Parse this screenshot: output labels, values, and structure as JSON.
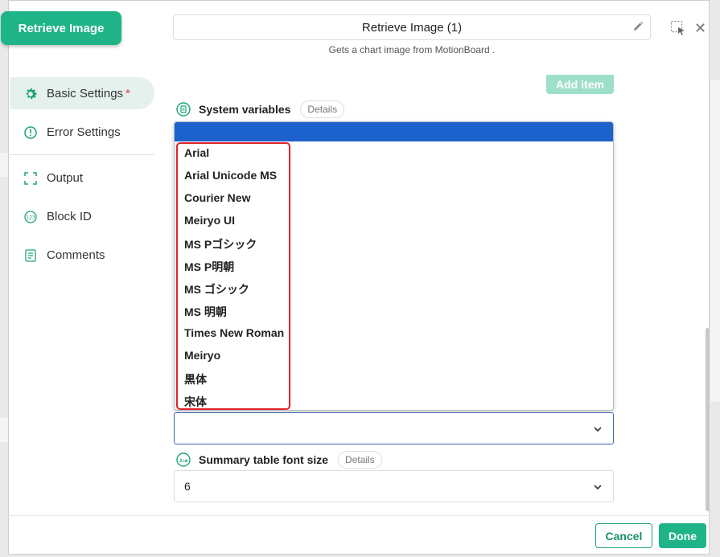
{
  "block_tag": "Retrieve Image",
  "header": {
    "title": "Retrieve Image (1)",
    "subtitle": "Gets a chart image from MotionBoard ."
  },
  "sidebar": {
    "items": [
      {
        "label": "Basic Settings",
        "required_mark": "*",
        "icon": "gear-icon",
        "active": true
      },
      {
        "label": "Error Settings",
        "icon": "alert-circle-icon"
      },
      {
        "label": "Output",
        "icon": "output-bracket-icon"
      },
      {
        "label": "Block ID",
        "icon": "block-id-icon"
      },
      {
        "label": "Comments",
        "icon": "comments-icon"
      }
    ]
  },
  "main": {
    "add_item_label": "Add item",
    "system_variables_label": "System variables",
    "details_label": "Details",
    "font_dropdown": {
      "options": [
        "Arial",
        "Arial Unicode MS",
        "Courier New",
        "Meiryo UI",
        "MS Pゴシック",
        "MS P明朝",
        "MS ゴシック",
        "MS 明朝",
        "Times New Roman",
        "Meiryo",
        "黒体",
        "宋体"
      ]
    },
    "summary_font_size_label": "Summary table font size",
    "summary_font_size_value": "6"
  },
  "footer": {
    "cancel_label": "Cancel",
    "done_label": "Done"
  },
  "colors": {
    "accent": "#1fb487",
    "selection": "#1d62cc",
    "highlight_border": "#e0202a"
  }
}
